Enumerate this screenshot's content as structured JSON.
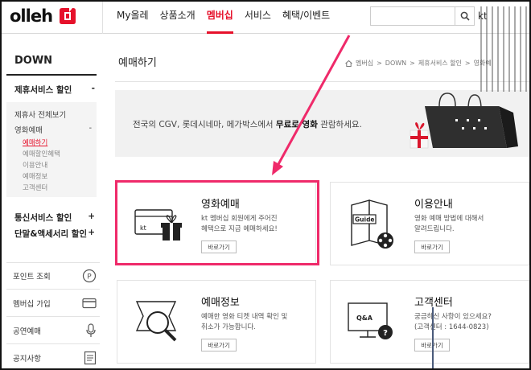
{
  "brand": {
    "name": "olleh",
    "accent": "#e6112b"
  },
  "gnb": {
    "items": [
      {
        "label": "My올레"
      },
      {
        "label": "상품소개"
      },
      {
        "label": "멤버십",
        "active": true
      },
      {
        "label": "서비스"
      },
      {
        "label": "혜택/이벤트"
      }
    ]
  },
  "search": {
    "value": "",
    "placeholder": "",
    "icon": "search-icon",
    "overflow_text": "kt"
  },
  "sidebar": {
    "title": "DOWN",
    "sections": [
      {
        "label": "제휴서비스 할인",
        "toggle": "-"
      },
      {
        "label": "통신서비스 할인",
        "toggle": "+"
      },
      {
        "label": "단말&액세서리 할인",
        "toggle": "+"
      }
    ],
    "sub": {
      "all": "제휴사 전체보기",
      "movie": {
        "label": "영화예매",
        "toggle": "-"
      },
      "items": [
        "예매하기",
        "예매할인혜택",
        "이용안내",
        "예매정보",
        "고객센터"
      ]
    },
    "quick": [
      {
        "label": "포인트 조회",
        "icon": "p-circle-icon"
      },
      {
        "label": "멤버십 가입",
        "icon": "card-icon"
      },
      {
        "label": "공연예매",
        "icon": "microphone-icon"
      },
      {
        "label": "공지사항",
        "icon": "notice-icon"
      }
    ]
  },
  "main": {
    "page_title": "예매하기",
    "breadcrumb": [
      "멤버십",
      "DOWN",
      "제휴서비스 할인",
      "영화예"
    ],
    "banner": {
      "text_before": "전국의 CGV, 롯데시네마, 메가박스에서 ",
      "text_bold": "무료로 영화",
      "text_after": " 관람하세요."
    },
    "cards": [
      {
        "title": "영화예매",
        "desc1": "kt 멤버십 회원에게 주어진",
        "desc2": "혜택으로 지금 예매하세요!",
        "button": "바로가기",
        "highlighted": true
      },
      {
        "title": "이용안내",
        "desc1": "영화 예매 방법에 대해서",
        "desc2": "알려드립니다.",
        "button": "바로가기",
        "icon_label": "Guide"
      },
      {
        "title": "예매정보",
        "desc1": "예매한 영화 티켓 내역 확인 및",
        "desc2": "취소가 가능합니다.",
        "button": "바로가기"
      },
      {
        "title": "고객센터",
        "desc1": "궁금하신 사항이 있으세요?",
        "desc2": "(고객센터 : 1644-0823)",
        "button": "바로가기",
        "icon_label": "Q&A"
      }
    ],
    "card_icon_texts": {
      "kt_label": "kt",
      "qa_mark": "?"
    }
  },
  "colors": {
    "highlight": "#ef2a6a",
    "annotation_arrow": "#ef2a6a"
  }
}
